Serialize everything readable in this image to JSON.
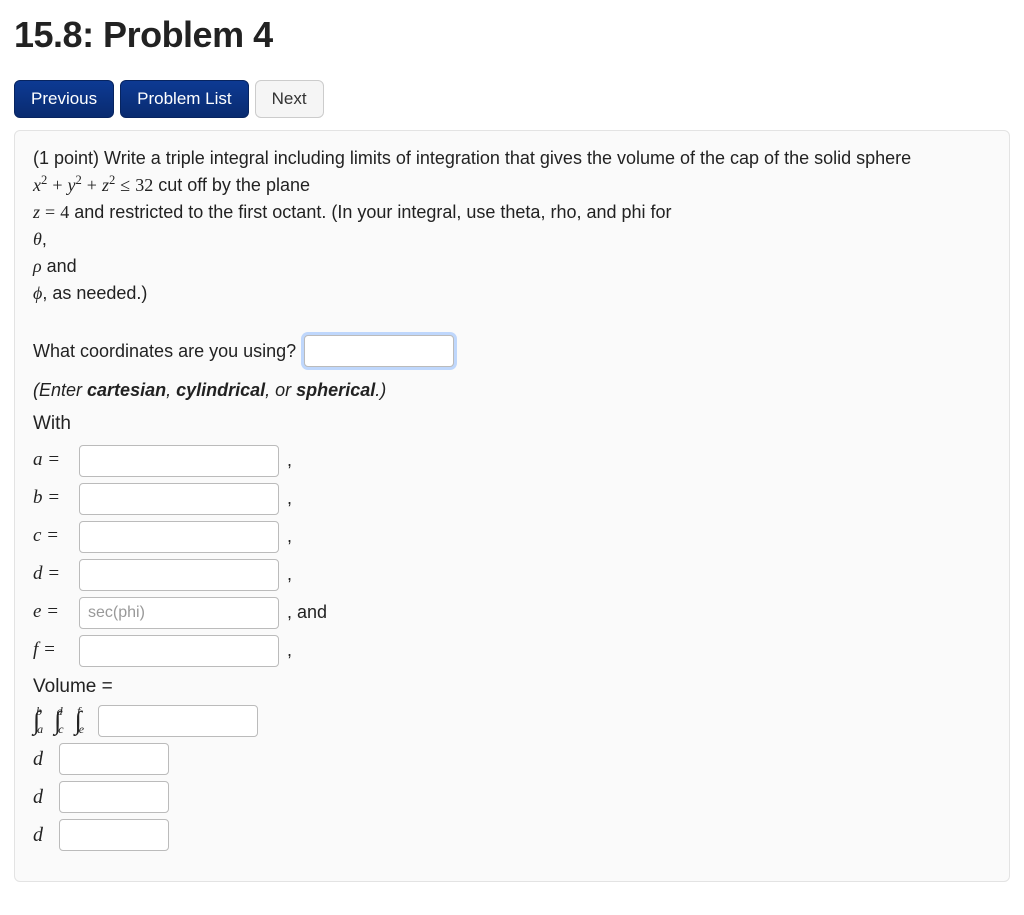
{
  "page_title": "15.8: Problem 4",
  "nav": {
    "previous": "Previous",
    "problem_list": "Problem List",
    "next": "Next"
  },
  "question": {
    "points_prefix": "(1 point) ",
    "line1": "Write a triple integral including limits of integration that gives the volume of the cap of the solid sphere",
    "sphere_ineq_rhs": "32",
    "line2_tail": " cut off by the plane",
    "plane_eq_rhs": "4",
    "line3_tail": " and restricted to the first octant. (In your integral, use theta, rho, and phi for",
    "theta_line_tail": ",",
    "rho_line_tail": " and",
    "phi_line_tail": ", as needed.)"
  },
  "coords_prompt": "What coordinates are you using?",
  "coords_hint_pre": "(Enter ",
  "coords_hint_1": "cartesian",
  "coords_hint_sep1": ", ",
  "coords_hint_2": "cylindrical",
  "coords_hint_sep2": ", or ",
  "coords_hint_3": "spherical",
  "coords_hint_post": ".)",
  "with_label": "With",
  "limits": {
    "a": {
      "label": "a =",
      "value": "",
      "after": ","
    },
    "b": {
      "label": "b =",
      "value": "",
      "after": ","
    },
    "c": {
      "label": "c =",
      "value": "",
      "after": ","
    },
    "d": {
      "label": "d =",
      "value": "",
      "after": ","
    },
    "e": {
      "label": "e =",
      "value": "",
      "placeholder": "sec(phi)",
      "after": ", and"
    },
    "f": {
      "label": "f =",
      "value": "",
      "after": ","
    }
  },
  "volume_label": "Volume =",
  "integral": {
    "outer_lo": "a",
    "outer_hi": "b",
    "mid_lo": "c",
    "mid_hi": "d",
    "inner_lo": "e",
    "inner_hi": "f",
    "integrand": "",
    "d_symbol": "d",
    "d1": "",
    "d2": "",
    "d3": ""
  },
  "coords_value": ""
}
